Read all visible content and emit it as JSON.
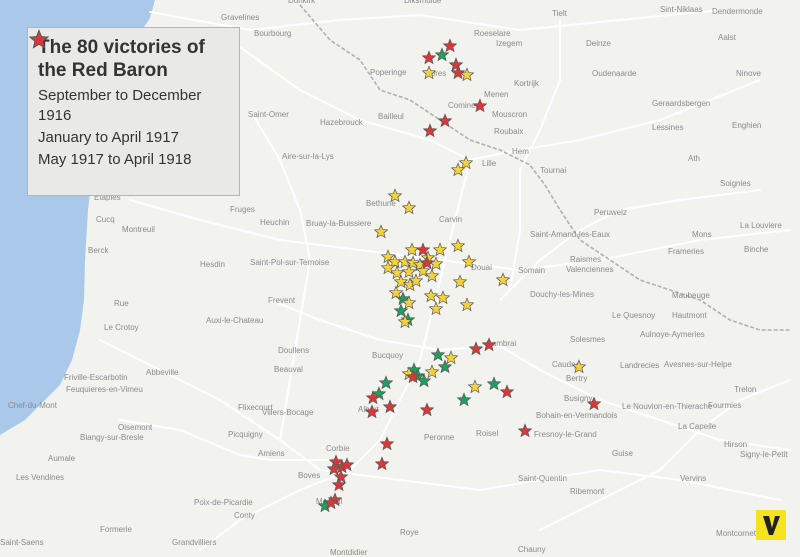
{
  "title": "The 80 victories of the Red Baron",
  "legend": [
    {
      "label": "September to December 1916",
      "color": "#1f9e5c"
    },
    {
      "label": "January to April 1917",
      "color": "#f4d23c"
    },
    {
      "label": "May 1917 to April 1918",
      "color": "#d8383a"
    }
  ],
  "colors": {
    "water": "#a9c8ea",
    "land": "#f2f2ef",
    "roads": "#ffffff",
    "border": "#b0b0b0",
    "star_outline": "#555555",
    "logo_bg": "#f5e31f"
  },
  "logo": {
    "letter": "V"
  },
  "places": [
    "Gravelines",
    "Dunkirk",
    "Diksmuide",
    "Roeselare",
    "Izegem",
    "Sint-Niklaas",
    "Dendermonde",
    "Tielt",
    "Deinze",
    "Aalst",
    "Bourbourg",
    "Poperinge",
    "Ypres",
    "Menen",
    "Kortrijk",
    "Oudenaarde",
    "Ninove",
    "Saint-Omer",
    "Hazebrouck",
    "Bailleul",
    "Comines",
    "Mouscron",
    "Roubaix",
    "Geraardsbergen",
    "Lessines",
    "Enghien",
    "Aire-sur-la-Lys",
    "Lille",
    "Hem",
    "Tournai",
    "Ath",
    "Soignies",
    "Etaples",
    "Cucq",
    "Montreuil",
    "Fruges",
    "Bethune",
    "Heuchin",
    "Bruay-la-Buissiere",
    "Carvin",
    "Saint-Amand-les-Eaux",
    "Peruwelz",
    "Mons",
    "La Louviere",
    "Berck",
    "Binche",
    "Hesdin",
    "Saint-Pol-sur-Ternoise",
    "Douai",
    "Somain",
    "Raismes",
    "Valenciennes",
    "Frameries",
    "Rue",
    "Frevent",
    "Douchy-les-Mines",
    "Maubeuge",
    "Le Crotoy",
    "Auxi-le-Chateau",
    "Hautmont",
    "Le Quesnoy",
    "Aulnoye-Aymeries",
    "Solesmes",
    "Doullens",
    "Cambrai",
    "Bucquoy",
    "Caudry",
    "Landrecies",
    "Avesnes-sur-Helpe",
    "Abbeville",
    "Friville-Escarbotin",
    "Feuquieres-en-Vimeu",
    "Beauval",
    "Bertry",
    "Trelon",
    "Chef-du-Mont",
    "Flixecourt",
    "Villers-Bocage",
    "Albert",
    "Busigny",
    "Le Nouvion-en-Thierache",
    "Fourmies",
    "Oisemont",
    "Bohain-en-Vermandois",
    "Blangy-sur-Bresle",
    "Picquigny",
    "Corbie",
    "Peronne",
    "Roisel",
    "Fresnoy-le-Grand",
    "La Capelle",
    "Hirson",
    "Aumale",
    "Amiens",
    "Guise",
    "Signy-le-Petit",
    "Les Vendines",
    "Boves",
    "Saint-Quentin",
    "Vervins",
    "Poix-de-Picardie",
    "Conty",
    "Moreuil",
    "Ribemont",
    "Montcornet",
    "Saint-Saens",
    "Formerie",
    "Grandvilliers",
    "Roye",
    "Montdidier",
    "Chauny"
  ],
  "victories": {
    "period1": [
      [
        442,
        55
      ],
      [
        403,
        299
      ],
      [
        401,
        311
      ],
      [
        408,
        320
      ],
      [
        438,
        355
      ],
      [
        445,
        367
      ],
      [
        386,
        383
      ],
      [
        379,
        394
      ],
      [
        414,
        370
      ],
      [
        418,
        376
      ],
      [
        424,
        381
      ],
      [
        494,
        384
      ],
      [
        464,
        400
      ],
      [
        325,
        506
      ]
    ],
    "period2": [
      [
        429,
        73
      ],
      [
        467,
        75
      ],
      [
        466,
        163
      ],
      [
        458,
        170
      ],
      [
        395,
        196
      ],
      [
        409,
        208
      ],
      [
        381,
        232
      ],
      [
        388,
        257
      ],
      [
        395,
        262
      ],
      [
        405,
        262
      ],
      [
        413,
        263
      ],
      [
        420,
        265
      ],
      [
        428,
        258
      ],
      [
        436,
        264
      ],
      [
        397,
        273
      ],
      [
        409,
        272
      ],
      [
        423,
        271
      ],
      [
        388,
        268
      ],
      [
        412,
        250
      ],
      [
        440,
        250
      ],
      [
        458,
        246
      ],
      [
        469,
        262
      ],
      [
        432,
        276
      ],
      [
        401,
        282
      ],
      [
        410,
        285
      ],
      [
        416,
        281
      ],
      [
        460,
        282
      ],
      [
        503,
        280
      ],
      [
        396,
        293
      ],
      [
        409,
        303
      ],
      [
        431,
        296
      ],
      [
        443,
        298
      ],
      [
        436,
        309
      ],
      [
        467,
        305
      ],
      [
        405,
        322
      ],
      [
        451,
        358
      ],
      [
        432,
        372
      ],
      [
        409,
        374
      ],
      [
        475,
        387
      ],
      [
        579,
        367
      ]
    ],
    "period3": [
      [
        429,
        58
      ],
      [
        450,
        46
      ],
      [
        456,
        65
      ],
      [
        458,
        73
      ],
      [
        480,
        106
      ],
      [
        445,
        121
      ],
      [
        430,
        131
      ],
      [
        423,
        250
      ],
      [
        427,
        263
      ],
      [
        476,
        349
      ],
      [
        489,
        345
      ],
      [
        507,
        392
      ],
      [
        413,
        377
      ],
      [
        373,
        398
      ],
      [
        390,
        407
      ],
      [
        372,
        412
      ],
      [
        427,
        410
      ],
      [
        594,
        404
      ],
      [
        525,
        431
      ],
      [
        387,
        444
      ],
      [
        382,
        464
      ],
      [
        336,
        462
      ],
      [
        342,
        467
      ],
      [
        347,
        465
      ],
      [
        334,
        469
      ],
      [
        341,
        477
      ],
      [
        339,
        485
      ],
      [
        335,
        500
      ],
      [
        331,
        503
      ]
    ]
  }
}
